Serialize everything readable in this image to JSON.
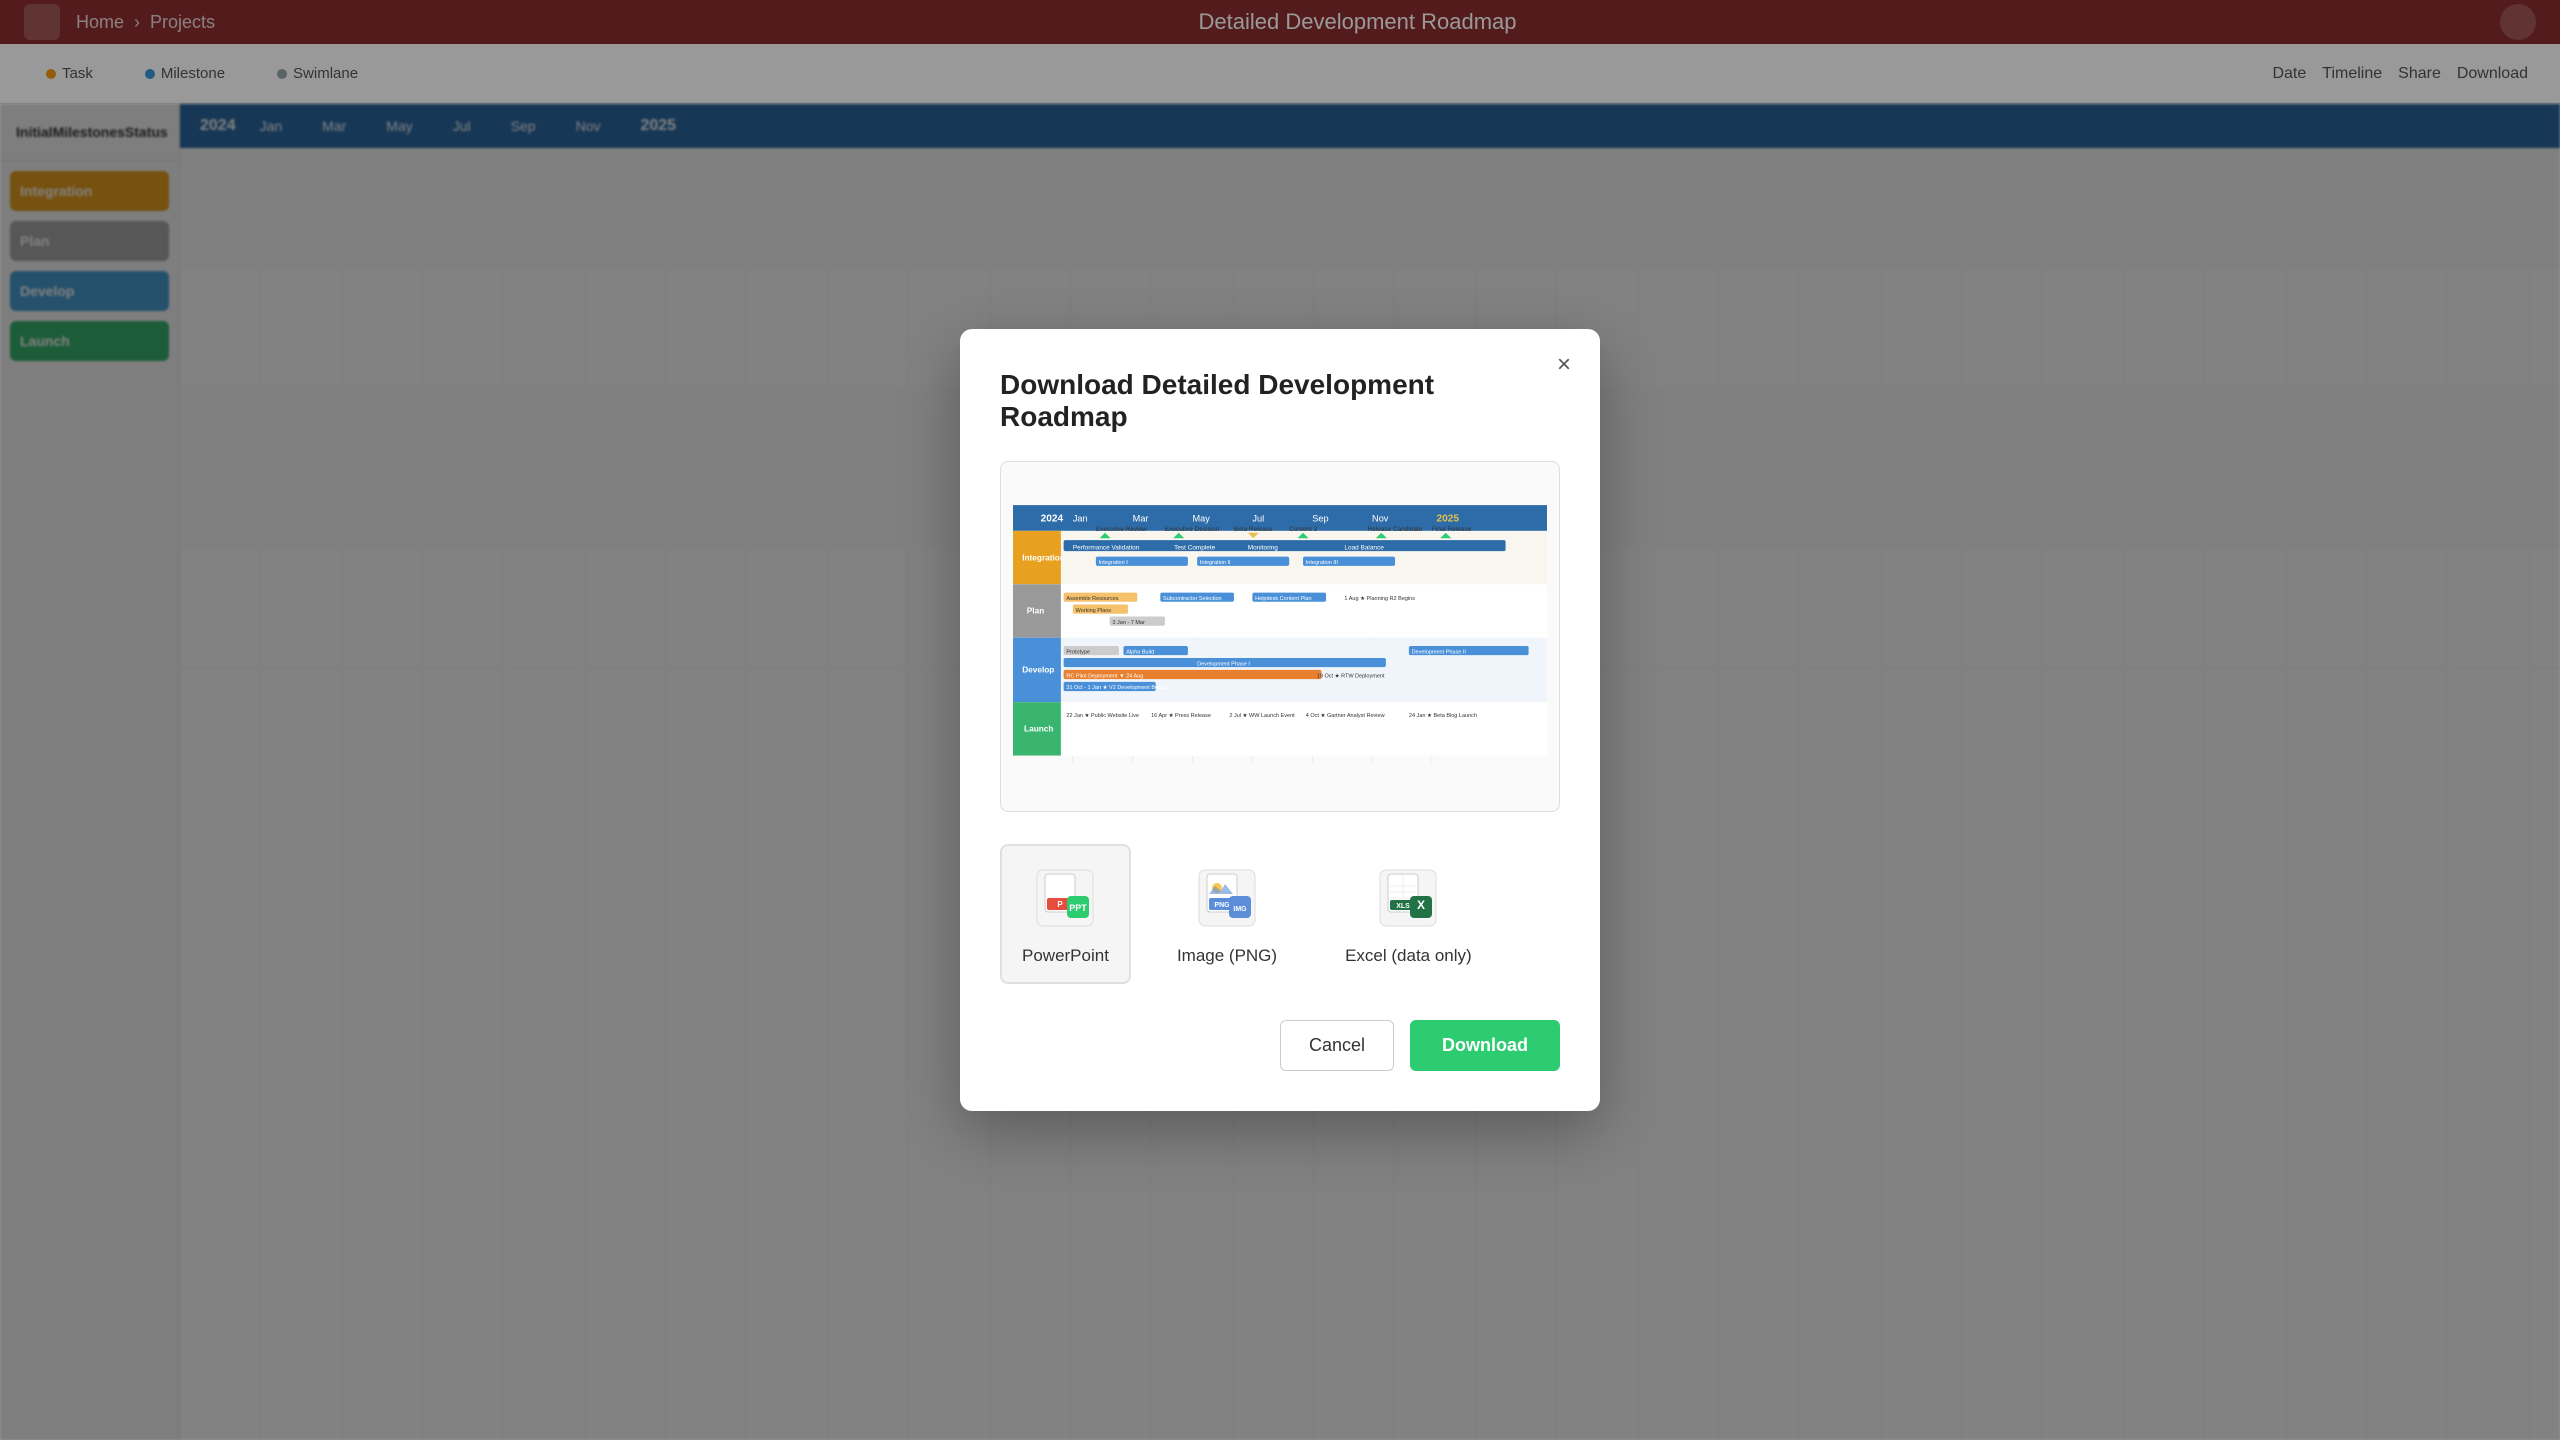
{
  "app": {
    "topbar_title": "Detailed Development Roadmap",
    "filter_task": "Task",
    "filter_milestone": "Milestone",
    "filter_swimlane": "Swimlane",
    "btn_date": "Date",
    "btn_timeline": "Timeline",
    "btn_share": "Share",
    "btn_download_top": "Download"
  },
  "modal": {
    "title": "Download Detailed Development Roadmap",
    "close_label": "×",
    "formats": [
      {
        "id": "powerpoint",
        "label": "PowerPoint",
        "selected": true
      },
      {
        "id": "png",
        "label": "Image (PNG)",
        "selected": false
      },
      {
        "id": "excel",
        "label": "Excel (data only)",
        "selected": false
      }
    ],
    "cancel_label": "Cancel",
    "download_label": "Download"
  },
  "gantt": {
    "rows": [
      {
        "label": "Integration",
        "color": "#f39c12"
      },
      {
        "label": "Plan",
        "color": "#95a5a6"
      },
      {
        "label": "Develop",
        "color": "#3498db"
      },
      {
        "label": "Launch",
        "color": "#2ecc71"
      }
    ],
    "year_start": "2024",
    "year_end": "2025",
    "months": [
      "Jan",
      "Mar",
      "May",
      "Jul",
      "Sep",
      "Nov",
      "2025"
    ]
  }
}
